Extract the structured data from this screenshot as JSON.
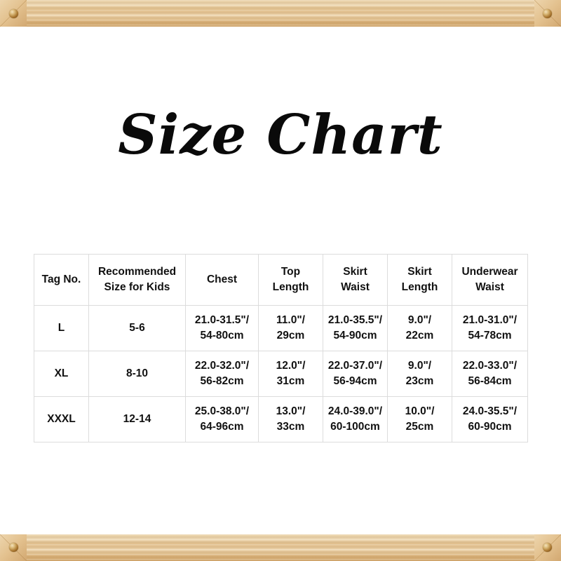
{
  "title": "Size Chart",
  "frame": {
    "material": "wood-frame",
    "wood_color": "#e3c18e",
    "screw_color": "#a9762f",
    "screws": [
      "screw-top-left",
      "screw-top-right",
      "screw-bottom-left",
      "screw-bottom-right"
    ]
  },
  "table": {
    "headers": [
      {
        "lines": [
          "Tag No."
        ]
      },
      {
        "lines": [
          "Recommended",
          "Size for Kids"
        ]
      },
      {
        "lines": [
          "Chest"
        ]
      },
      {
        "lines": [
          "Top",
          "Length"
        ]
      },
      {
        "lines": [
          "Skirt",
          "Waist"
        ]
      },
      {
        "lines": [
          "Skirt",
          "Length"
        ]
      },
      {
        "lines": [
          "Underwear",
          "Waist"
        ]
      }
    ],
    "rows": [
      {
        "tag": "L",
        "kids_size": "5-6",
        "chest": [
          "21.0-31.5\"/",
          "54-80cm"
        ],
        "top_length": [
          "11.0\"/",
          "29cm"
        ],
        "skirt_waist": [
          "21.0-35.5\"/",
          "54-90cm"
        ],
        "skirt_length": [
          "9.0\"/",
          "22cm"
        ],
        "underwear_waist": [
          "21.0-31.0\"/",
          "54-78cm"
        ]
      },
      {
        "tag": "XL",
        "kids_size": "8-10",
        "chest": [
          "22.0-32.0\"/",
          "56-82cm"
        ],
        "top_length": [
          "12.0\"/",
          "31cm"
        ],
        "skirt_waist": [
          "22.0-37.0\"/",
          "56-94cm"
        ],
        "skirt_length": [
          "9.0\"/",
          "23cm"
        ],
        "underwear_waist": [
          "22.0-33.0\"/",
          "56-84cm"
        ]
      },
      {
        "tag": "XXXL",
        "kids_size": "12-14",
        "chest": [
          "25.0-38.0\"/",
          "64-96cm"
        ],
        "top_length": [
          "13.0\"/",
          "33cm"
        ],
        "skirt_waist": [
          "24.0-39.0\"/",
          "60-100cm"
        ],
        "skirt_length": [
          "10.0\"/",
          "25cm"
        ],
        "underwear_waist": [
          "24.0-35.5\"/",
          "60-90cm"
        ]
      }
    ]
  }
}
